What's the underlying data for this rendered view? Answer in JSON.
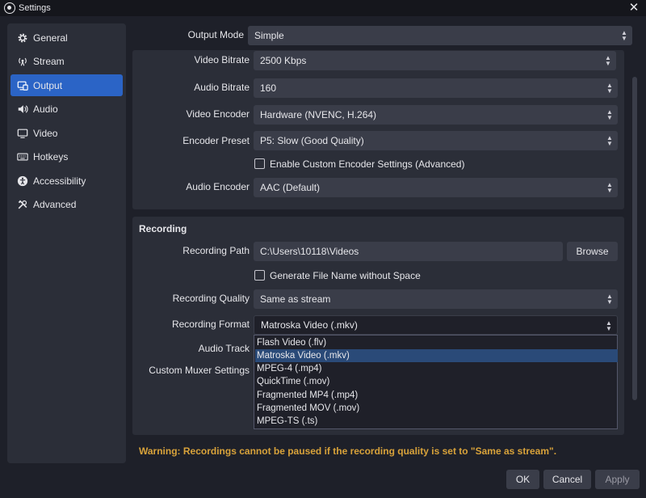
{
  "window": {
    "title": "Settings"
  },
  "sidebar": {
    "items": [
      {
        "label": "General",
        "icon": "gear-icon"
      },
      {
        "label": "Stream",
        "icon": "antenna-icon"
      },
      {
        "label": "Output",
        "icon": "monitor-output-icon",
        "active": true
      },
      {
        "label": "Audio",
        "icon": "speaker-icon"
      },
      {
        "label": "Video",
        "icon": "monitor-icon"
      },
      {
        "label": "Hotkeys",
        "icon": "keyboard-icon"
      },
      {
        "label": "Accessibility",
        "icon": "accessibility-icon"
      },
      {
        "label": "Advanced",
        "icon": "tools-icon"
      }
    ]
  },
  "output_mode": {
    "label": "Output Mode",
    "value": "Simple"
  },
  "streaming": {
    "video_bitrate": {
      "label": "Video Bitrate",
      "value": "2500 Kbps"
    },
    "audio_bitrate": {
      "label": "Audio Bitrate",
      "value": "160"
    },
    "video_encoder": {
      "label": "Video Encoder",
      "value": "Hardware (NVENC, H.264)"
    },
    "encoder_preset": {
      "label": "Encoder Preset",
      "value": "P5: Slow (Good Quality)"
    },
    "custom_encoder": {
      "label": "Enable Custom Encoder Settings (Advanced)",
      "checked": false
    },
    "audio_encoder": {
      "label": "Audio Encoder",
      "value": "AAC (Default)"
    }
  },
  "recording": {
    "title": "Recording",
    "path": {
      "label": "Recording Path",
      "value": "C:\\Users\\10118\\Videos",
      "browse_label": "Browse"
    },
    "no_space": {
      "label": "Generate File Name without Space",
      "checked": false
    },
    "quality": {
      "label": "Recording Quality",
      "value": "Same as stream"
    },
    "format": {
      "label": "Recording Format",
      "value": "Matroska Video (.mkv)",
      "options": [
        "Flash Video (.flv)",
        "Matroska Video (.mkv)",
        "MPEG-4 (.mp4)",
        "QuickTime (.mov)",
        "Fragmented MP4 (.mp4)",
        "Fragmented MOV (.mov)",
        "MPEG-TS (.ts)"
      ],
      "selected_index": 1
    },
    "audio_track": {
      "label": "Audio Track"
    },
    "muxer": {
      "label": "Custom Muxer Settings"
    }
  },
  "warning": "Warning: Recordings cannot be paused if the recording quality is set to \"Same as stream\".",
  "buttons": {
    "ok": "OK",
    "cancel": "Cancel",
    "apply": "Apply"
  }
}
